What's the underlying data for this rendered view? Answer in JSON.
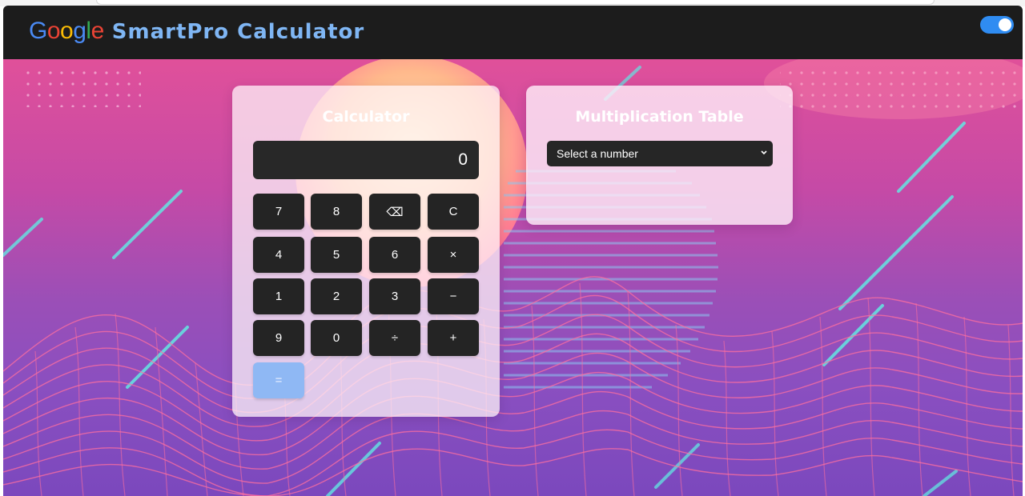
{
  "navbar": {
    "logo_letters": [
      "G",
      "o",
      "o",
      "g",
      "l",
      "e"
    ],
    "logo_colors": [
      "#4a8af4",
      "#ea4335",
      "#fbbc05",
      "#4a8af4",
      "#34a853",
      "#ea4335"
    ],
    "app_title": "SmartPro Calculator",
    "theme_toggle_on": true,
    "toggle_color": "#2f8cf2"
  },
  "calculator": {
    "title": "Calculator",
    "display_value": "0",
    "keys": [
      [
        "7",
        "8",
        "⌫",
        "C"
      ],
      [
        "4",
        "5",
        "6",
        "×"
      ],
      [
        "1",
        "2",
        "3",
        "−"
      ],
      [
        "9",
        "0",
        "÷",
        "+"
      ],
      [
        "="
      ]
    ],
    "equals_color": "#8fb8f4"
  },
  "multiplication_table": {
    "title": "Multiplication Table",
    "select_value": "Select a number"
  },
  "background": {
    "gradient_top": "#e0509a",
    "gradient_bottom": "#7b48bd",
    "mesh_color": "#ff6f9f",
    "streak_color": "#63e6e2"
  }
}
